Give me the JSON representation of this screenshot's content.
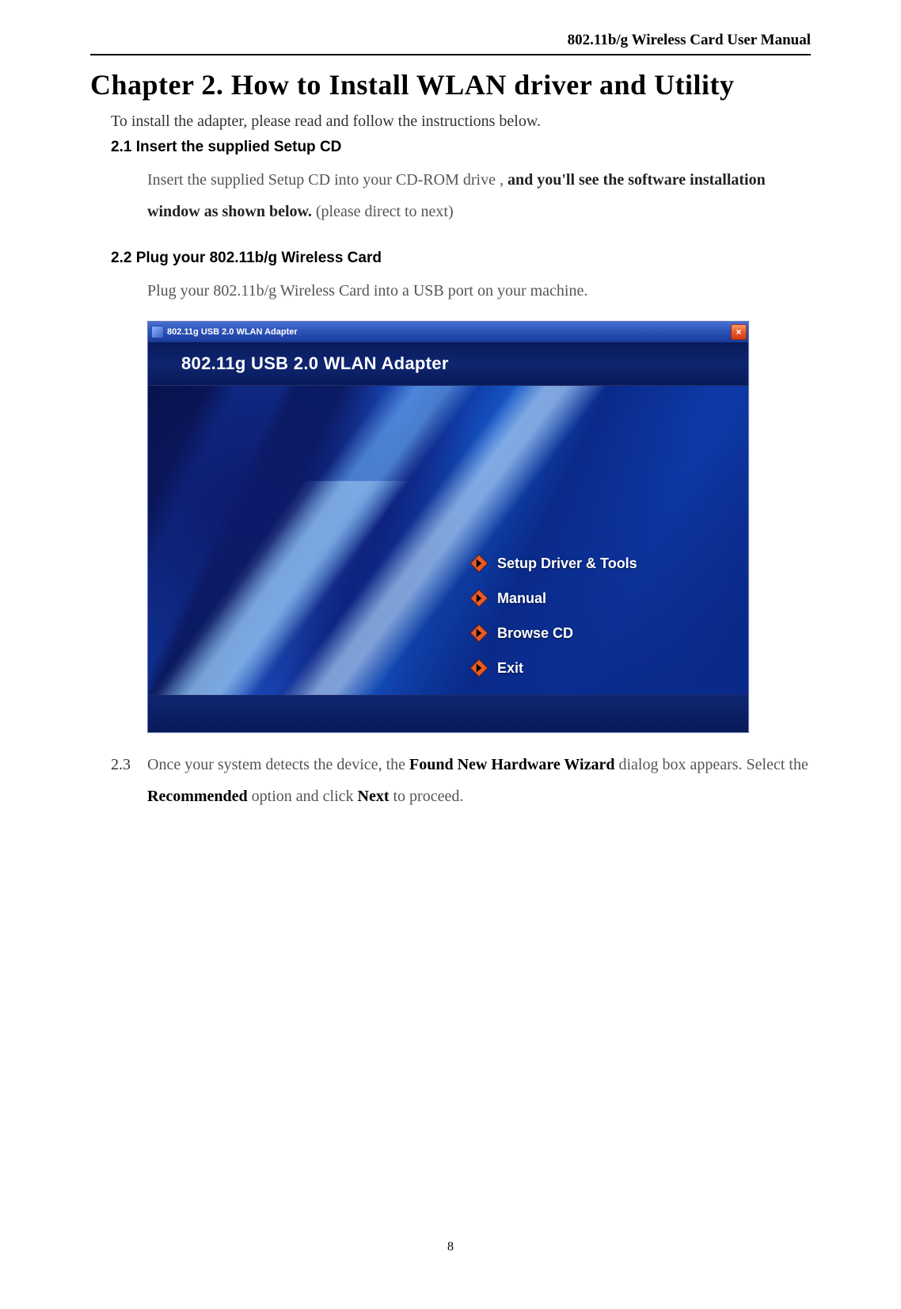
{
  "header": {
    "manual_title": "802.11b/g Wireless Card User Manual"
  },
  "chapter": {
    "title": "Chapter 2. How to Install WLAN driver and Utility",
    "intro": "To install the adapter, please read and follow the instructions below."
  },
  "section21": {
    "heading": "2.1 Insert the supplied Setup CD",
    "text_part_a": "Insert the supplied Setup CD into your CD-ROM drive , ",
    "text_part_b_bold": "and you'll see the software installation window as shown below.",
    "text_part_c_grey": " (please direct to next)"
  },
  "section22": {
    "heading": "2.2 Plug your 802.11b/g Wireless Card",
    "text": "Plug your 802.11b/g Wireless Card into a USB port on your machine."
  },
  "installer": {
    "window_title": "802.11g USB 2.0 WLAN Adapter",
    "banner_title": "802.11g USB 2.0 WLAN Adapter",
    "close_label": "×",
    "menu": {
      "setup": "Setup Driver & Tools",
      "manual": "Manual",
      "browse": "Browse CD",
      "exit": "Exit"
    }
  },
  "section23": {
    "number": "2.3",
    "pre": "Once your system detects the device, the ",
    "bold1": "Found New Hardware Wizard",
    "mid1": " dialog box appears. Select the ",
    "bold2": "Recommended",
    "mid2": " option and click ",
    "bold3": "Next",
    "post": " to proceed."
  },
  "page_number": "8"
}
